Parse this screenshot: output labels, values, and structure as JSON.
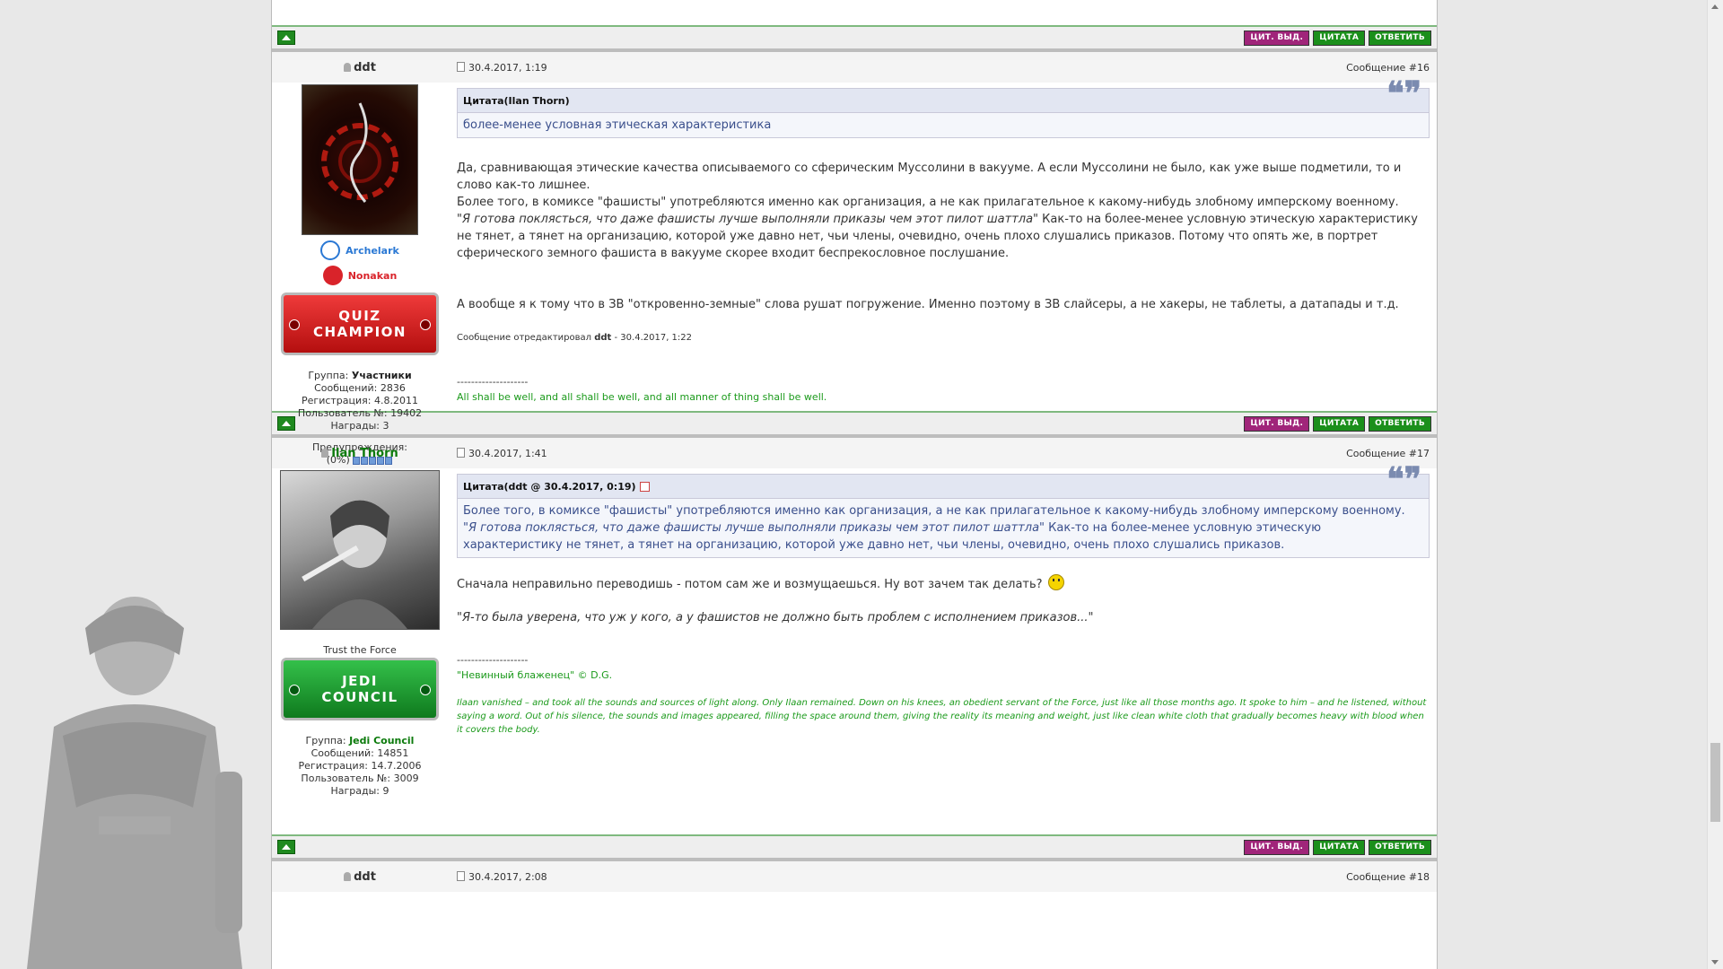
{
  "buttons": {
    "quote_selected": "ЦИТ. ВЫД.",
    "quote": "ЦИТАТА",
    "reply": "ОТВЕТИТЬ"
  },
  "posts": [
    {
      "author": "ddt",
      "date": "30.4.2017, 1:19",
      "number": "Сообщение #16",
      "quote_title": "Цитата(Ilan Thorn)",
      "quote_text": "более-менее условная этическая характеристика",
      "p1": "Да, сравнивающая этические качества описываемого со сферическим Муссолини в вакууме. А если Муссолини не было, как уже выше подметили, то и слово как-то лишнее.",
      "p2": "Более того, в комиксе \"фашисты\" употребляются именно как организация, а не как прилагательное к какому-нибудь злобному имперскому военному.",
      "p3_italic": "\"Я готова поклясться, что даже фашисты лучше выполняли приказы чем этот пилот шаттла\"",
      "p3_rest": " Как-то на более-менее условную этическую характеристику не тянет, а тянет на организацию, которой уже давно нет, чьи члены, очевидно, очень плохо слушались приказов. Потому что опять же, в портрет сферического земного фашиста в вакууме скорее входит беспрекословное послушание.",
      "p4": "А вообще я к тому что в ЗВ \"откровенно-земные\" слова рушат погружение. Именно поэтому в ЗВ слайсеры, а не хакеры, не таблеты, а датапады и т.д.",
      "edit_prefix": "Сообщение отредактировал ",
      "edit_author": "ddt",
      "edit_suffix": " - 30.4.2017, 1:22",
      "sig_sep": "--------------------",
      "sig": "All shall be well, and all shall be well, and all manner of thing shall be well.",
      "awards": [
        "Archelark",
        "Nonakan"
      ],
      "badge_line1": "QUIZ",
      "badge_line2": "CHAMPION",
      "group_label": "Группа: ",
      "group": "Участники",
      "messages": "Сообщений: 2836",
      "registered": "Регистрация: 4.8.2011",
      "user_no": "Пользователь №: 19402",
      "rewards": "Награды: 3",
      "warnings_label": "Предупреждения:",
      "warnings_value": "(0%)"
    },
    {
      "author": "Ilan Thorn",
      "date": "30.4.2017, 1:41",
      "number": "Сообщение #17",
      "quote_title": "Цитата(ddt @ 30.4.2017, 0:19)",
      "quote_text1": "Более того, в комиксе \"фашисты\" употребляются именно как организация, а не как прилагательное к какому-нибудь злобному имперскому военному.",
      "quote_italic": "\"Я готова поклясться, что даже фашисты лучше выполняли приказы чем этот пилот шаттла\"",
      "quote_rest": " Как-то на более-менее условную этическую характеристику не тянет, а тянет на организацию, которой уже давно нет, чьи члены, очевидно, очень плохо слушались приказов.",
      "p1": "Сначала неправильно переводишь - потом сам же и возмущаешься. Ну вот зачем так делать?",
      "p2": "\"Я-то была уверена, что уж у кого, а у фашистов не должно быть проблем с исполнением приказов...\"",
      "sig_sep": "--------------------",
      "sig1": "\"Невинный блаженец\" © D.G.",
      "sig2": "Ilaan vanished – and took all the sounds and sources of light along. Only Ilaan remained. Down on his knees, an obedient servant of the Force, just like all those months ago. It spoke to him – and he listened, without saying a word. Out of his silence, the sounds and images appeared, filling the space around them, giving the reality its meaning and weight, just like clean white cloth that gradually becomes heavy with blood when it covers the body.",
      "title": "Trust the Force",
      "badge_line1": "JEDI",
      "badge_line2": "COUNCIL",
      "group_label": "Группа: ",
      "group": "Jedi Council",
      "messages": "Сообщений: 14851",
      "registered": "Регистрация: 14.7.2006",
      "user_no": "Пользователь №: 3009",
      "rewards": "Награды: 9"
    },
    {
      "author": "ddt",
      "date": "30.4.2017, 2:08",
      "number": "Сообщение #18"
    }
  ],
  "colors": {
    "green_accent": "#1b8f1b",
    "purple_button": "#a0257a",
    "quote_text": "#3a4f8c",
    "signature": "#1b9a1b"
  }
}
